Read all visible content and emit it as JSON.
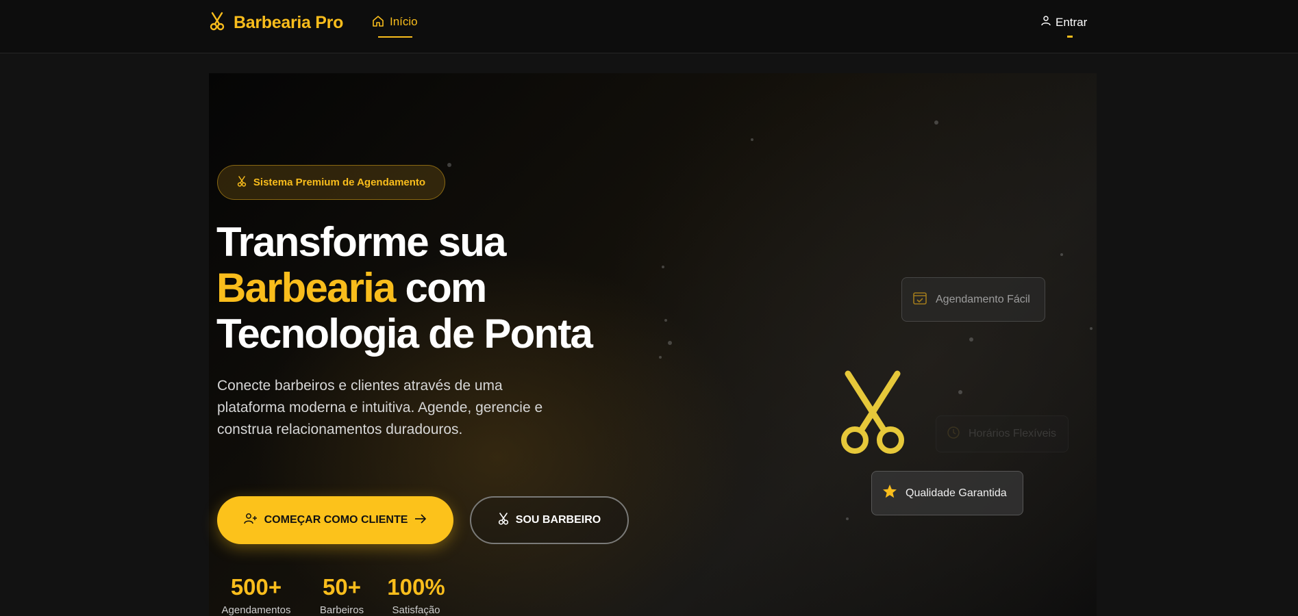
{
  "header": {
    "brand": "Barbearia Pro",
    "nav_home": "Início",
    "login": "Entrar"
  },
  "hero": {
    "badge": "Sistema Premium de Agendamento",
    "headline_line1": "Transforme sua",
    "headline_accent": "Barbearia",
    "headline_line2_rest": " com",
    "headline_line3": "Tecnologia de Ponta",
    "subtitle": "Conecte barbeiros e clientes através de uma plataforma moderna e intuitiva. Agende, gerencie e construa relacionamentos duradouros.",
    "cta_primary": "COMEÇAR COMO CLIENTE",
    "cta_secondary": "SOU BARBEIRO"
  },
  "stats": [
    {
      "value": "500+",
      "label": "Agendamentos"
    },
    {
      "value": "50+",
      "label": "Barbeiros"
    },
    {
      "value": "100%",
      "label": "Satisfação"
    }
  ],
  "features": [
    {
      "label": "Agendamento Fácil",
      "icon": "calendar-check-icon"
    },
    {
      "label": "Horários Flexíveis",
      "icon": "clock-icon"
    },
    {
      "label": "Qualidade Garantida",
      "icon": "star-icon"
    }
  ],
  "colors": {
    "accent": "#f9bd1c",
    "background": "#121212",
    "header": "#0d0d0d"
  }
}
